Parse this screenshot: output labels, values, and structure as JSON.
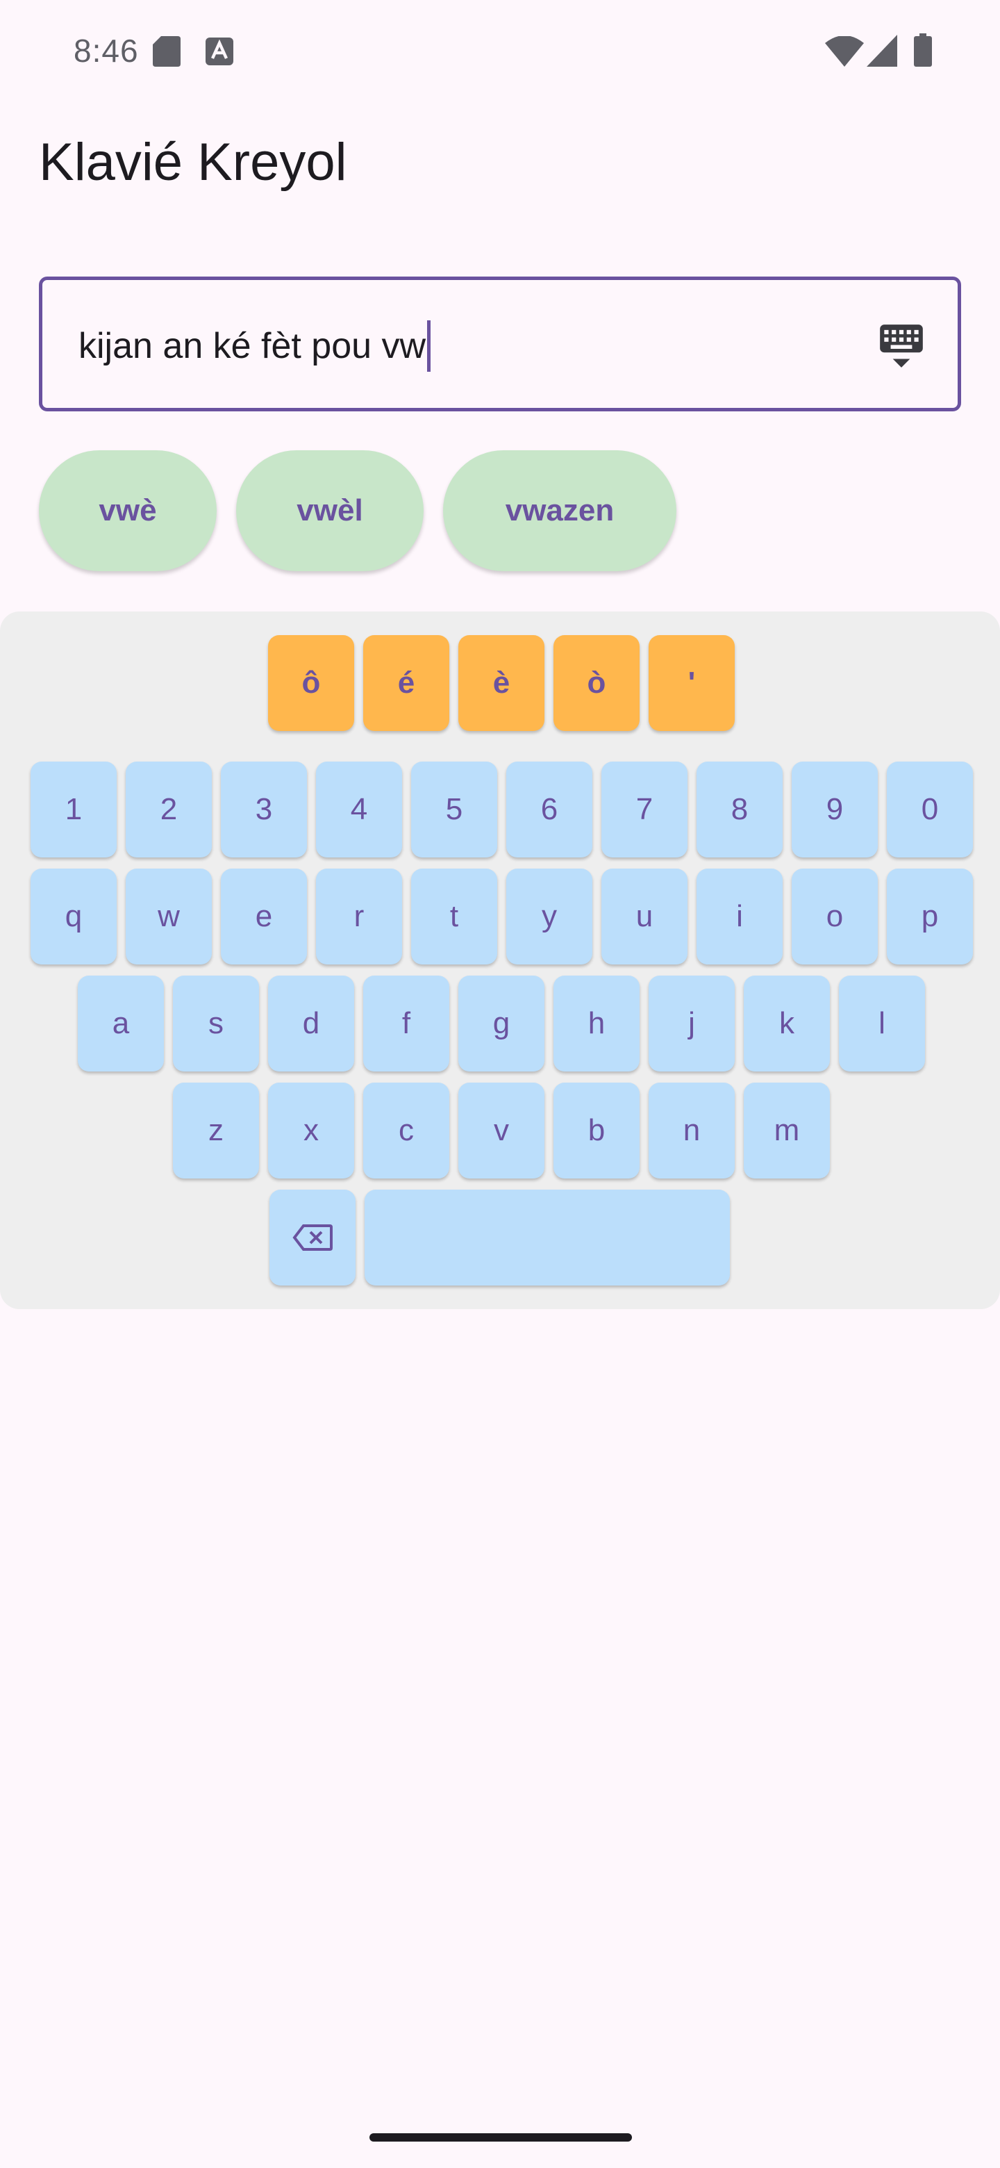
{
  "status_bar": {
    "time": "8:46",
    "icons": [
      "sd-card-icon",
      "a-notification-icon",
      "wifi-icon",
      "signal-icon",
      "battery-icon"
    ]
  },
  "app": {
    "title": "Klavié Kreyol"
  },
  "input": {
    "value": "kijan an ké fèt pou vw",
    "toggle_icon": "keyboard-hide-icon"
  },
  "suggestions": [
    "vwè",
    "vwèl",
    "vwazen"
  ],
  "keyboard": {
    "accent_row": [
      "ô",
      "é",
      "è",
      "ò",
      "'"
    ],
    "number_row": [
      "1",
      "2",
      "3",
      "4",
      "5",
      "6",
      "7",
      "8",
      "9",
      "0"
    ],
    "row1": [
      "q",
      "w",
      "e",
      "r",
      "t",
      "y",
      "u",
      "i",
      "o",
      "p"
    ],
    "row2": [
      "a",
      "s",
      "d",
      "f",
      "g",
      "h",
      "j",
      "k",
      "l"
    ],
    "row3": [
      "z",
      "x",
      "c",
      "v",
      "b",
      "n",
      "m"
    ],
    "backspace_icon": "backspace-icon",
    "space_label": ""
  },
  "colors": {
    "background": "#fef7fc",
    "accent": "#6a529f",
    "key": "#bbdefb",
    "accent_key": "#ffb74d",
    "chip": "#c8e6c9",
    "keyboard_bg": "#eeeeee"
  }
}
